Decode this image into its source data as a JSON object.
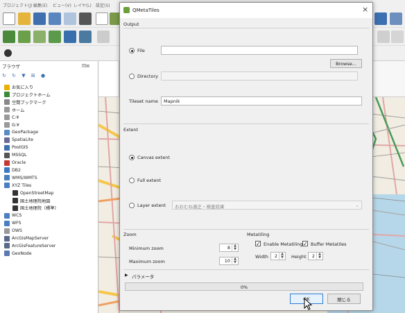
{
  "qgis": {
    "menubar": [
      "プロジェクト(J)",
      "編集(E)",
      "ビュー(V)",
      "レイヤ(L)",
      "設定(S)"
    ],
    "browser": {
      "title": "ブラウザ",
      "items": [
        {
          "label": "お気に入り",
          "color": "#e8b000"
        },
        {
          "label": "プロジェクトホーム",
          "color": "#3a8a3a"
        },
        {
          "label": "空間ブックマーク",
          "color": "#888888"
        },
        {
          "label": "ホーム",
          "color": "#999999"
        },
        {
          "label": "C:¥",
          "color": "#999999"
        },
        {
          "label": "G:¥",
          "color": "#999999"
        },
        {
          "label": "GeoPackage",
          "color": "#5a8bc4"
        },
        {
          "label": "SpatiaLite",
          "color": "#6a6a9a"
        },
        {
          "label": "PostGIS",
          "color": "#3f6fae"
        },
        {
          "label": "MSSQL",
          "color": "#555555"
        },
        {
          "label": "Oracle",
          "color": "#c4362f"
        },
        {
          "label": "DB2",
          "color": "#3c78c4"
        },
        {
          "label": "WMS/WMTS",
          "color": "#4a7fc1"
        },
        {
          "label": "XYZ Tiles",
          "color": "#4a7fc1"
        },
        {
          "label": "OpenStreetMap",
          "color": "#333333"
        },
        {
          "label": "国土地理院地図",
          "color": "#333333"
        },
        {
          "label": "国土地理院（標準）",
          "color": "#333333"
        },
        {
          "label": "WCS",
          "color": "#4a7fc1"
        },
        {
          "label": "WFS",
          "color": "#4a7fc1"
        },
        {
          "label": "OWS",
          "color": "#999999"
        },
        {
          "label": "ArcGisMapServer",
          "color": "#5a6a8a"
        },
        {
          "label": "ArcGisFeatureServer",
          "color": "#5a6a8a"
        },
        {
          "label": "GeoNode",
          "color": "#5a7ab0"
        }
      ]
    }
  },
  "dialog": {
    "title": "QMetaTiles",
    "close_symbol": "×",
    "output": {
      "section": "Output",
      "file_label": "File",
      "file_value": "",
      "browse_label": "Browse...",
      "directory_label": "Directory",
      "directory_value": "",
      "tileset_label": "Tileset name",
      "tileset_value": "Mapnik"
    },
    "extent": {
      "section": "Extent",
      "canvas_label": "Canvas extent",
      "full_label": "Full extent",
      "layer_label": "Layer extent",
      "layer_value": "おおむね適正・検査結果"
    },
    "zoom": {
      "section": "Zoom",
      "min_label": "Minimum zoom",
      "min_value": "8",
      "max_label": "Maximum zoom",
      "max_value": "10"
    },
    "metatiling": {
      "section": "Metatiling",
      "enable_label": "Enable Metatiling",
      "buffer_label": "Buffer Metatiles",
      "width_label": "Width",
      "width_value": "2",
      "height_label": "Height",
      "height_value": "2"
    },
    "params_label": "パラメータ",
    "progress": {
      "percent": 0,
      "text": "0%"
    },
    "ok_label": "OK",
    "close_label": "閉じる"
  }
}
